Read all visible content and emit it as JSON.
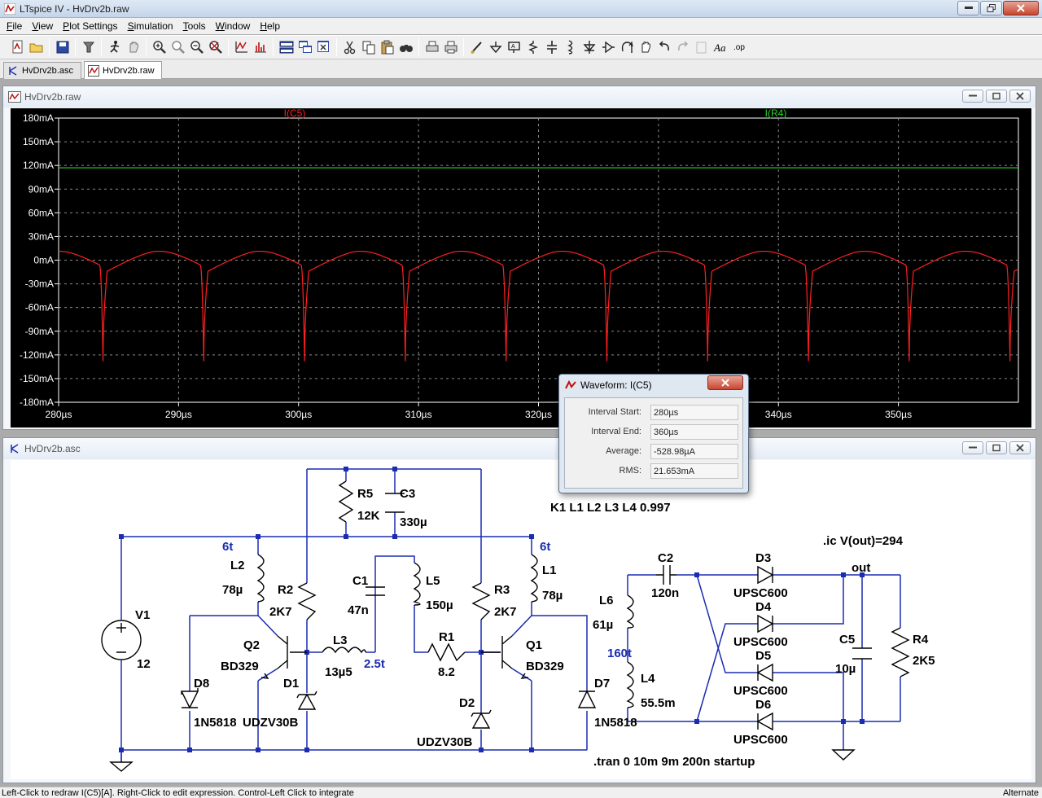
{
  "window": {
    "title": "LTspice IV - HvDrv2b.raw"
  },
  "menu": [
    {
      "label": "File",
      "key": "F",
      "rest": "ile"
    },
    {
      "label": "View",
      "key": "V",
      "rest": "iew"
    },
    {
      "label": "Plot Settings",
      "key": "P",
      "rest": "lot Settings"
    },
    {
      "label": "Simulation",
      "key": "S",
      "rest": "imulation"
    },
    {
      "label": "Tools",
      "key": "T",
      "rest": "ools"
    },
    {
      "label": "Window",
      "key": "W",
      "rest": "indow"
    },
    {
      "label": "Help",
      "key": "H",
      "rest": "elp"
    }
  ],
  "tabs": [
    {
      "label": "HvDrv2b.asc",
      "active": false
    },
    {
      "label": "HvDrv2b.raw",
      "active": true
    }
  ],
  "plot_window": {
    "title": "HvDrv2b.raw"
  },
  "schematic_window": {
    "title": "HvDrv2b.asc"
  },
  "chart_data": {
    "type": "line",
    "title": "",
    "xlabel": "",
    "ylabel": "",
    "xlim": [
      280,
      360
    ],
    "ylim": [
      -180,
      180
    ],
    "x_unit": "µs",
    "y_unit": "mA",
    "grid": true,
    "background": "#000000",
    "x_ticks": [
      "280µs",
      "290µs",
      "300µs",
      "310µs",
      "320µs",
      "330µs",
      "340µs",
      "350µs"
    ],
    "x_tick_values": [
      280,
      290,
      300,
      310,
      320,
      330,
      340,
      350
    ],
    "y_ticks": [
      "180mA",
      "150mA",
      "120mA",
      "90mA",
      "60mA",
      "30mA",
      "0mA",
      "-30mA",
      "-60mA",
      "-90mA",
      "-120mA",
      "-150mA",
      "-180mA"
    ],
    "y_tick_values": [
      180,
      150,
      120,
      90,
      60,
      30,
      0,
      -30,
      -60,
      -90,
      -120,
      -150,
      -180
    ],
    "series": [
      {
        "name": "I(C5)",
        "color": "#ff2020",
        "period": 8.4,
        "first_spike": 283.7,
        "peak": 15,
        "trough": -128,
        "x": [
          280,
          283.7,
          292.1,
          300.5,
          308.9,
          317.3,
          325.7,
          334.1,
          342.5,
          350.9,
          359.3
        ],
        "y": [
          10,
          -128,
          -128,
          -128,
          -128,
          -128,
          -128,
          -128,
          -128,
          -128,
          -128
        ]
      },
      {
        "name": "I(R4)",
        "color": "#29d629",
        "x": [
          280,
          360
        ],
        "y": [
          117,
          117
        ]
      }
    ]
  },
  "waveform_dialog": {
    "title": "Waveform: I(C5)",
    "rows": [
      {
        "label": "Interval Start:",
        "value": "280µs"
      },
      {
        "label": "Interval End:",
        "value": "360µs"
      },
      {
        "label": "Average:",
        "value": "-528.98µA"
      },
      {
        "label": "RMS:",
        "value": "21.653mA"
      }
    ]
  },
  "schematic": {
    "labels": {
      "R5": "R5",
      "R5v": "12K",
      "C3": "C3",
      "C3v": "330µ",
      "K1": "K1 L1 L2 L3 L4 0.997",
      "ic": ".ic V(out)=294",
      "L2": "L2",
      "L2v": "78µ",
      "L2t": "6t",
      "L1": "L1",
      "L1v": "78µ",
      "L1t": "6t",
      "R2": "R2",
      "R2v": "2K7",
      "R3": "R3",
      "R3v": "2K7",
      "C1": "C1",
      "C1v": "47n",
      "L5": "L5",
      "L5v": "150µ",
      "V1": "V1",
      "V1v": "12",
      "Q2": "Q2",
      "Q2m": "BD329",
      "Q1": "Q1",
      "Q1m": "BD329",
      "L3": "L3",
      "L3v": "13µ5",
      "L3t": "2.5t",
      "R1": "R1",
      "R1v": "8.2",
      "D8": "D8",
      "D8m": "1N5818",
      "D1": "D1",
      "D1m": "UDZV30B",
      "D2": "D2",
      "D2m": "UDZV30B",
      "D7": "D7",
      "D7m": "1N5818",
      "C2": "C2",
      "C2v": "120n",
      "L6": "L6",
      "L6v": "61µ",
      "L6t": "160t",
      "L4": "L4",
      "L4v": "55.5m",
      "D3": "D3",
      "D3m": "UPSC600",
      "D4": "D4",
      "D4m": "UPSC600",
      "D5": "D5",
      "D5m": "UPSC600",
      "D6": "D6",
      "D6m": "UPSC600",
      "out": "out",
      "C5": "C5",
      "C5v": "10µ",
      "R4": "R4",
      "R4v": "2K5",
      "tran": ".tran 0 10m 9m 200n startup"
    }
  },
  "status": {
    "left": "Left-Click to redraw I(C5)[A]. Right-Click to edit expression. Control-Left Click to integrate",
    "right": "Alternate"
  }
}
